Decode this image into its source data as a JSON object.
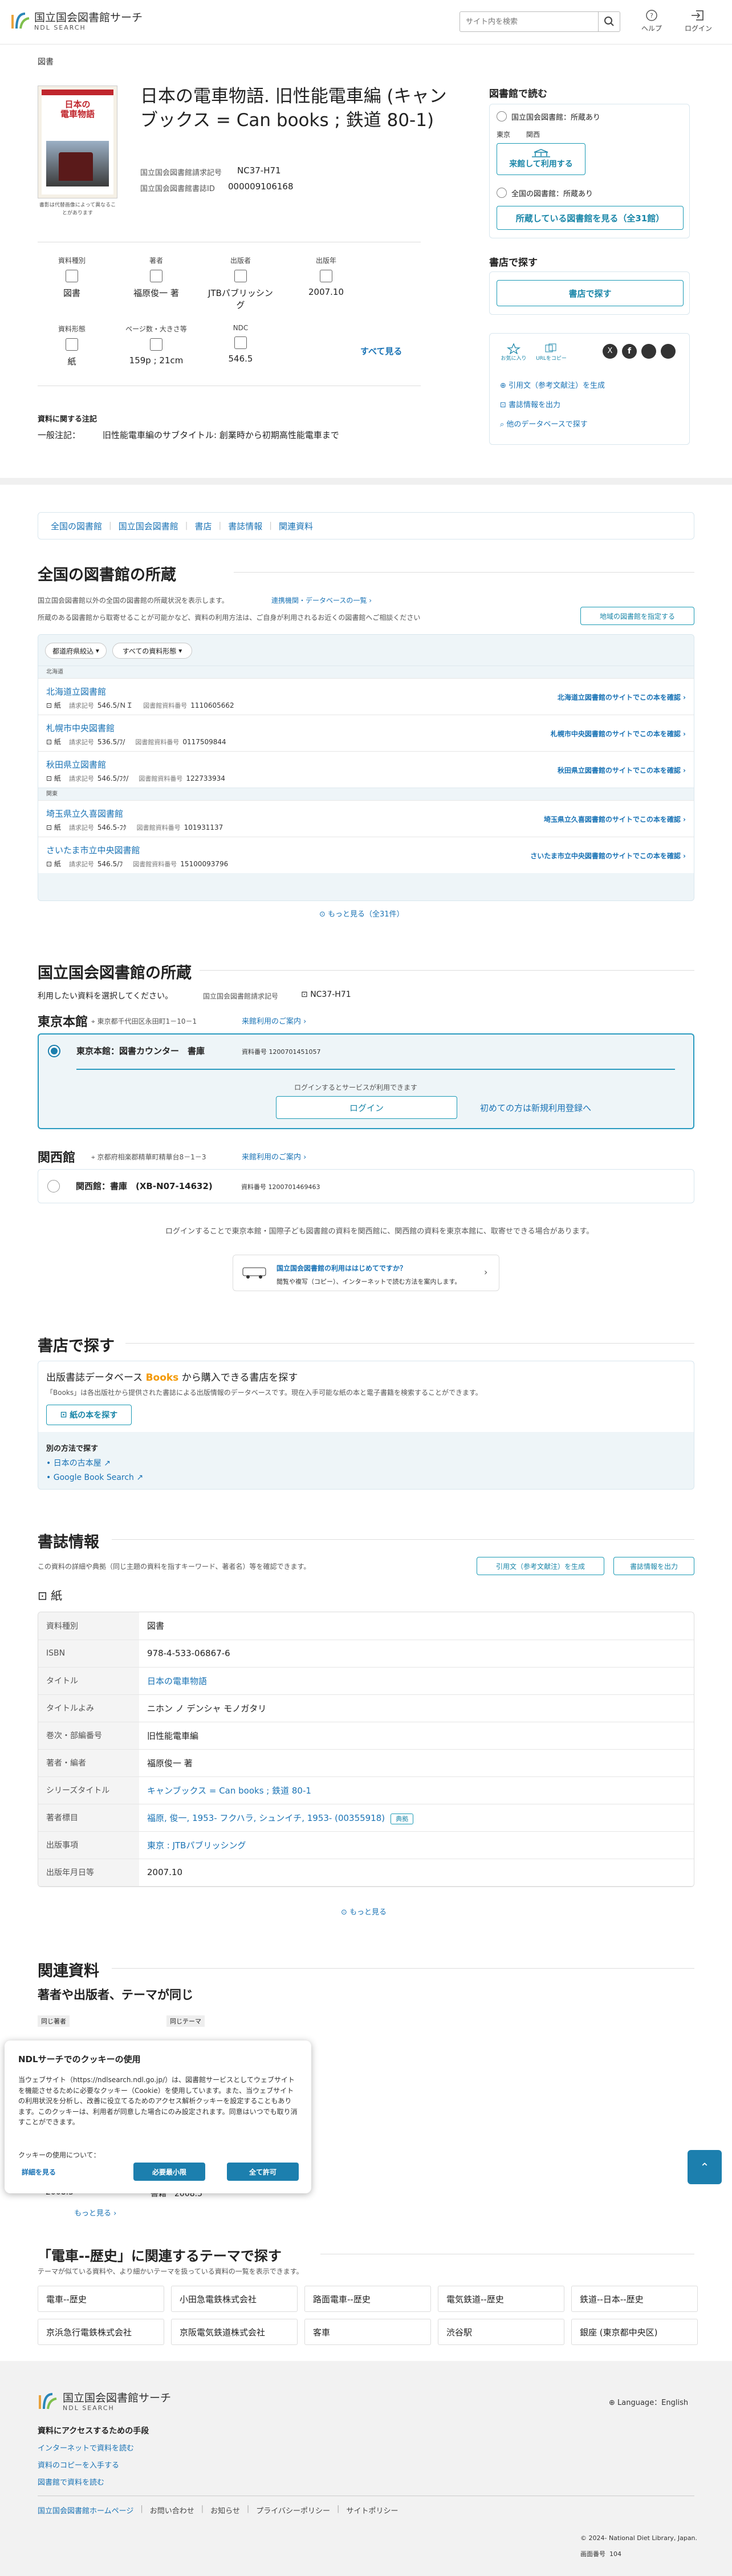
{
  "header": {
    "logo_title": "国立国会図書館サーチ",
    "logo_sub": "NDL SEARCH",
    "search_placeholder": "サイト内を検索",
    "help": "ヘルプ",
    "login": "ログイン"
  },
  "breadcrumb": "図書",
  "book": {
    "cover_caption": "書影は代替画像によって異なることがあります",
    "title": "日本の電車物語. 旧性能電車編 (キャンブックス = Can books ; 鉄道 80-1)",
    "callno_label": "国立国会図書館請求記号",
    "callno": "NC37-H71",
    "bibid_label": "国立国会図書館書誌ID",
    "bibid": "000009106168"
  },
  "facets": [
    {
      "label": "資料種別",
      "value": "図書",
      "icon": "book-icon"
    },
    {
      "label": "著者",
      "value": "福原俊一 著",
      "icon": "person-icon"
    },
    {
      "label": "出版者",
      "value": "JTBパブリッシング",
      "icon": "building-icon"
    },
    {
      "label": "出版年",
      "value": "2007.10",
      "icon": "calendar-icon"
    },
    {
      "label": "資料形態",
      "value": "紙",
      "icon": "paper-icon"
    },
    {
      "label": "ページ数・大きさ等",
      "value": "159p ; 21cm",
      "icon": "ruler-icon"
    },
    {
      "label": "NDC",
      "value": "546.5",
      "icon": "stack-icon"
    }
  ],
  "see_all": "すべて見る",
  "note": {
    "title": "資料に関する注記",
    "label": "一般注記：",
    "text": "旧性能電車編のサブタイトル: 創業時から初期高性能電車まで"
  },
  "side": {
    "read_title": "図書館で読む",
    "ndl_status": "国立国会図書館：所蔵あり",
    "tokyo": "東京",
    "kansai": "関西",
    "ndl_btn": "来館して利用する",
    "all_status": "全国の図書館：所蔵あり",
    "all_btn": "所蔵している図書館を見る（全31館）",
    "buy_title": "書店で探す",
    "buy_btn": "書店で探す",
    "share1": "お気に入り",
    "share2": "URLをコピー",
    "cite": "引用文（参考文献注）を生成",
    "export": "書誌情報を出力",
    "other_db": "他のデータベースで探す"
  },
  "tabs": [
    "全国の図書館",
    "国立国会図書館",
    "書店",
    "書誌情報",
    "関連資料"
  ],
  "national": {
    "title": "全国の図書館の所蔵",
    "desc1": "国立国会図書館以外の全国の図書館の所蔵状況を表示します。",
    "desc_link": "連携機関・データベースの一覧",
    "desc2": "所蔵のある図書館から取寄せることが可能かなど、資料の利用方法は、ご自身が利用されるお近くの図書館へご相談ください",
    "region_btn": "地域の図書館を指定する",
    "filter1": "都道府県絞込",
    "filter2": "すべての資料形態",
    "groups": [
      {
        "name": "北海道",
        "libs": [
          {
            "name": "北海道立図書館",
            "type": "紙",
            "callno": "546.5/ＮＩ",
            "libid": "1110605662",
            "link": "北海道立図書館のサイトでこの本を確認"
          },
          {
            "name": "札幌市中央図書館",
            "type": "紙",
            "callno": "536.5/ﾌ/",
            "libid": "0117509844",
            "link": "札幌市中央図書館のサイトでこの本を確認"
          },
          {
            "name": "秋田県立図書館",
            "type": "紙",
            "callno": "546.5/ﾌｸ/",
            "libid": "122733934",
            "link": "秋田県立図書館のサイトでこの本を確認"
          }
        ]
      },
      {
        "name": "関東",
        "libs": [
          {
            "name": "埼玉県立久喜図書館",
            "type": "紙",
            "callno": "546.5-ﾌｸ",
            "libid": "101931137",
            "link": "埼玉県立久喜図書館のサイトでこの本を確認"
          },
          {
            "name": "さいたま市立中央図書館",
            "type": "紙",
            "callno": "546.5/ﾌ",
            "libid": "15100093796",
            "link": "さいたま市立中央図書館のサイトでこの本を確認"
          }
        ]
      }
    ],
    "callno_label": "請求記号",
    "libid_label": "図書館資料番号",
    "more": "もっと見る（全31件）"
  },
  "ndl": {
    "title": "国立国会図書館の所蔵",
    "desc": "利用したい資料を選択してください。",
    "callno_label": "国立国会図書館請求記号",
    "callno": "NC37-H71",
    "tokyo": "東京本館",
    "tokyo_addr": "東京都千代田区永田町1－10－1",
    "tokyo_guide": "来館利用のご案内",
    "item1": "東京本館：図書カウンター　書庫",
    "item1_id": "資料番号 1200701451057",
    "login_hint": "ログインするとサービスが利用できます",
    "login_btn": "ログイン",
    "register": "初めての方は新規利用登録へ",
    "kansai": "関西館",
    "kansai_addr": "京都府相楽郡精華町精華台8－1－3",
    "kansai_guide": "来館利用のご案内",
    "item2": "関西館：書庫　(XB-N07-14632)",
    "item2_id": "資料番号 1200701469463",
    "transfer": "ログインすることで東京本館・国際子ども図書館の資料を関西館に、関西館の資料を東京本館に、取寄せできる場合があります。",
    "first_title": "国立国会図書館の利用ははじめてですか？",
    "first_sub": "閲覧や複写（コピー）、インターネットで読む方法を案内します。"
  },
  "store": {
    "title": "書店で探す",
    "head": "出版書誌データベース",
    "books": "Books",
    "head2": "から購入できる書店を探す",
    "desc": "「Books」は各出版社から提供された書誌による出版情報のデータベースです。現在入手可能な紙の本と電子書籍を検索することができます。",
    "btn": "紙の本を探す",
    "other": "別の方法で探す",
    "link1": "日本の古本屋",
    "link2": "Google Book Search"
  },
  "biblio": {
    "title": "書誌情報",
    "desc": "この資料の詳細や典拠（同じ主題の資料を指すキーワード、著者名）等を確認できます。",
    "cite": "引用文（参考文献注）を生成",
    "export": "書誌情報を出力",
    "type": "紙",
    "rows": [
      {
        "k": "資料種別",
        "v": "図書"
      },
      {
        "k": "ISBN",
        "v": "978-4-533-06867-6"
      },
      {
        "k": "タイトル",
        "v": "日本の電車物語",
        "link": true
      },
      {
        "k": "タイトルよみ",
        "v": "ニホン ノ デンシャ モノガタリ"
      },
      {
        "k": "巻次・部編番号",
        "v": "旧性能電車編"
      },
      {
        "k": "著者・編者",
        "v": "福原俊一 著"
      },
      {
        "k": "シリーズタイトル",
        "v": "キャンブックス = Can books ; 鉄道 80-1",
        "link": true
      },
      {
        "k": "著者標目",
        "v": "福原, 俊一, 1953- フクハラ, シュンイチ, 1953- (00355918)",
        "link": true,
        "badge": "典拠"
      },
      {
        "k": "出版事項",
        "v": "東京 : JTBパブリッシング",
        "link": true
      },
      {
        "k": "出版年月日等",
        "v": "2007.10"
      }
    ],
    "more": "もっと見る"
  },
  "related": {
    "title": "関連資料",
    "sub": "著者や出版者、テーマが同じ",
    "tag1": "同じ著者",
    "tag2": "同じテーマ",
    "year1": "2008.3",
    "year2": "書籍　2008.5",
    "more": "もっと見る"
  },
  "cookie": {
    "title": "NDLサーチでのクッキーの使用",
    "text": "当ウェブサイト（https://ndlsearch.ndl.go.jp/）は、図書館サービスとしてウェブサイトを機能させるために必要なクッキー（Cookie）を使用しています。また、当ウェブサイトの利用状況を分析し、改善に役立てるためのアクセス解析クッキーを設定することもあります。このクッキーは、利用者が同意した場合にのみ設定されます。同意はいつでも取り消すことができます。",
    "q": "クッキーの使用について：",
    "detail": "詳細を見る",
    "necessary": "必要最小限",
    "allow": "全て許可"
  },
  "themes": {
    "title": "「電車--歴史」に関連するテーマで探す",
    "desc": "テーマが似ている資料や、より細かいテーマを扱っている資料の一覧を表示できます。",
    "items": [
      "電車--歴史",
      "小田急電鉄株式会社",
      "路面電車--歴史",
      "電気鉄道--歴史",
      "鉄道--日本--歴史",
      "京浜急行電鉄株式会社",
      "京阪電気鉄道株式会社",
      "客車",
      "渋谷駅",
      "銀座 (東京都中央区)"
    ]
  },
  "footer": {
    "logo_title": "国立国会図書館サーチ",
    "logo_sub": "NDL SEARCH",
    "lang": "Language：English",
    "access_title": "資料にアクセスするための手段",
    "access1": "インターネットで資料を読む",
    "access2": "資料のコピーを入手する",
    "access3": "図書館で資料を読む",
    "links": [
      "国立国会図書館ホームページ",
      "お問い合わせ",
      "お知らせ",
      "プライバシーポリシー",
      "サイトポリシー"
    ],
    "copyright": "© 2024- National Diet Library, Japan.",
    "page_label": "画面番号",
    "page_no": "104"
  },
  "colors": {
    "accent": "#1c7fae",
    "teal": "#1a9ab5",
    "orange": "#f39800"
  }
}
